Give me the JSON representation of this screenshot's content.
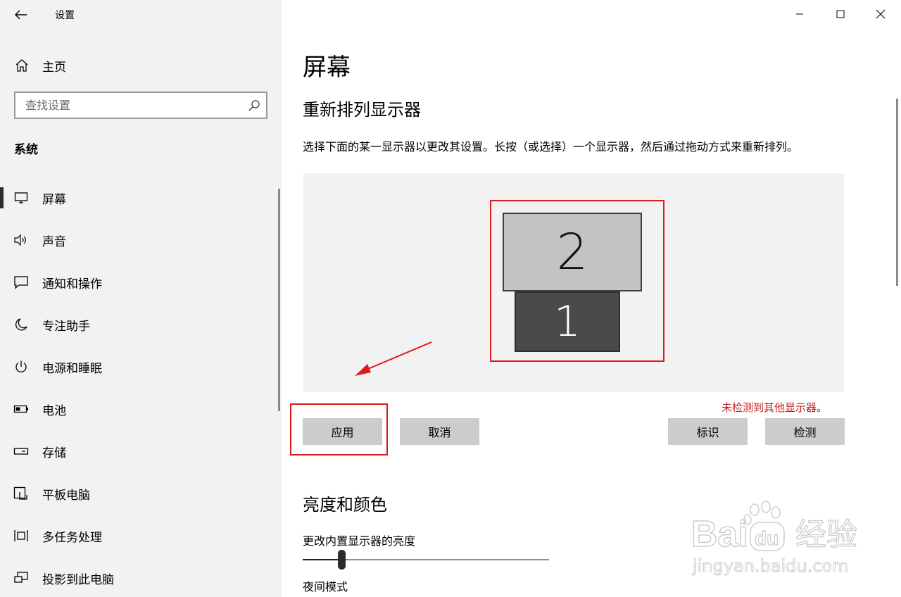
{
  "window": {
    "title": "设置"
  },
  "sidebar": {
    "home_label": "主页",
    "search_placeholder": "查找设置",
    "section_label": "系统",
    "items": [
      {
        "label": "屏幕",
        "icon": "monitor-icon",
        "active": true
      },
      {
        "label": "声音",
        "icon": "speaker-icon"
      },
      {
        "label": "通知和操作",
        "icon": "message-icon"
      },
      {
        "label": "专注助手",
        "icon": "moon-icon"
      },
      {
        "label": "电源和睡眠",
        "icon": "power-icon"
      },
      {
        "label": "电池",
        "icon": "battery-icon"
      },
      {
        "label": "存储",
        "icon": "storage-icon"
      },
      {
        "label": "平板电脑",
        "icon": "tablet-icon"
      },
      {
        "label": "多任务处理",
        "icon": "multitask-icon"
      },
      {
        "label": "投影到此电脑",
        "icon": "project-icon"
      }
    ]
  },
  "main": {
    "page_title": "屏幕",
    "arrange": {
      "title": "重新排列显示器",
      "description": "选择下面的某一显示器以更改其设置。长按（或选择）一个显示器，然后通过拖动方式来重新排列。",
      "monitor_2_label": "2",
      "monitor_1_label": "1",
      "status": "未检测到其他显示器。",
      "apply_label": "应用",
      "cancel_label": "取消",
      "identify_label": "标识",
      "detect_label": "检测"
    },
    "brightness": {
      "title": "亮度和颜色",
      "label": "更改内置显示器的亮度",
      "value": 16,
      "night_label": "夜间模式"
    }
  },
  "watermark": {
    "brand": "Bai",
    "brand_cn": "经验",
    "url": "jingyan.baidu.com"
  },
  "colors": {
    "highlight": "#e01a1a",
    "status": "#c81d1d",
    "sidebar_bg": "#f2f2f2"
  }
}
